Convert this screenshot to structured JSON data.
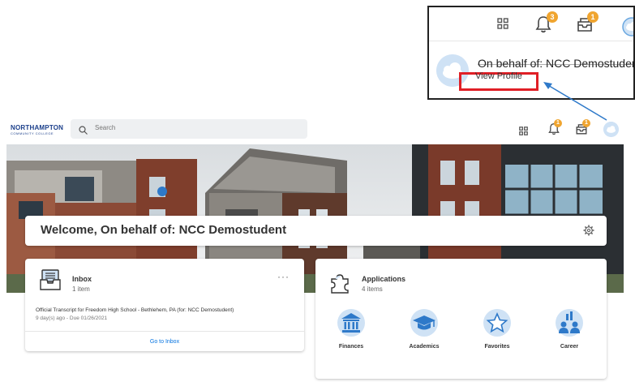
{
  "callout": {
    "bell_badge": "3",
    "tray_badge": "1",
    "user_name": "On behalf of: NCC Demostudent",
    "view_profile": "View Profile"
  },
  "header": {
    "logo_main": "NORTHAMPTON",
    "logo_sub": "COMMUNITY COLLEGE",
    "search_placeholder": "Search",
    "bell_badge": "1",
    "tray_badge": "1"
  },
  "welcome": {
    "title": "Welcome, On behalf of: NCC Demostudent"
  },
  "inbox": {
    "title": "Inbox",
    "count": "1 item",
    "more": "···",
    "item_title": "Official Transcript for Freedom High School - Bethlehem, PA (for: NCC Demostudent)",
    "item_sub": "9 day(s) ago - Due 01/26/2021",
    "goto": "Go to Inbox"
  },
  "applications": {
    "title": "Applications",
    "count": "4 items",
    "items": [
      {
        "label": "Finances",
        "icon": "bank-icon"
      },
      {
        "label": "Academics",
        "icon": "graduation-cap-icon"
      },
      {
        "label": "Favorites",
        "icon": "star-icon"
      },
      {
        "label": "Career",
        "icon": "people-chart-icon"
      }
    ]
  },
  "colors": {
    "accent": "#0875e1",
    "badge": "#f0a530",
    "highlight": "#e01f26",
    "icon_blue": "#2e79c9",
    "icon_bg": "#cfe2f5"
  }
}
